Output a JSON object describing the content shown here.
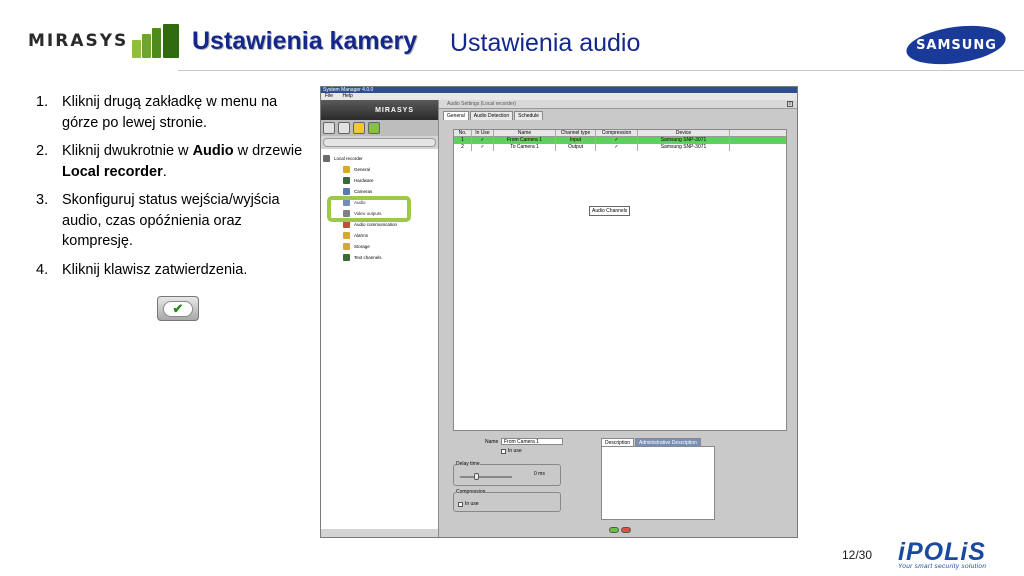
{
  "header": {
    "brand_left": "MIRASYS",
    "title": "Ustawienia kamery",
    "subtitle": "Ustawienia audio",
    "brand_right": "SAMSUNG"
  },
  "steps": [
    {
      "num": "1.",
      "parts": [
        {
          "t": "Kliknij drugą zakładkę w menu na górze po lewej stronie."
        }
      ]
    },
    {
      "num": "2.",
      "parts": [
        {
          "t": "Kliknij dwukrotnie w "
        },
        {
          "t": "Audio",
          "b": true
        },
        {
          "t": " w drzewie "
        },
        {
          "t": "Local recorder",
          "b": true
        },
        {
          "t": "."
        }
      ]
    },
    {
      "num": "3.",
      "parts": [
        {
          "t": "Skonfiguruj status wejścia/wyjścia audio, czas opóźnienia oraz kompresję."
        }
      ]
    },
    {
      "num": "4.",
      "parts": [
        {
          "t": "Kliknij klawisz zatwierdzenia."
        }
      ]
    }
  ],
  "confirm_icon": "checkmark-icon",
  "app": {
    "window_title": "System Manager 4.0.0",
    "menu": [
      "File",
      "Help"
    ],
    "banner": "MIRASYS",
    "tree": [
      {
        "label": "Local recorder",
        "level": 0,
        "icon": "sec"
      },
      {
        "label": "General",
        "level": 1,
        "icon": "g"
      },
      {
        "label": "Hardware",
        "level": 1,
        "icon": "c"
      },
      {
        "label": "Cameras",
        "level": 1,
        "icon": "b"
      },
      {
        "label": "Audio",
        "level": 1,
        "icon": "b"
      },
      {
        "label": "Video outputs",
        "level": 1,
        "icon": "sec"
      },
      {
        "label": "Audio communication",
        "level": 1,
        "icon": "r"
      },
      {
        "label": "Alarms",
        "level": 1,
        "icon": "g"
      },
      {
        "label": "Storage",
        "level": 1,
        "icon": "g"
      },
      {
        "label": "Text channels",
        "level": 1,
        "icon": "c"
      }
    ],
    "dialog_title": "Audio Settings (Local recorder)",
    "tabs": [
      "General",
      "Audio Detection",
      "Schedule"
    ],
    "table": {
      "columns": [
        "No.",
        "In Use",
        "Name",
        "Channel type",
        "Compression",
        "Device"
      ],
      "rows": [
        [
          "1",
          "✓",
          "From Camera 1",
          "Input",
          "✓",
          "Samsung SNP-3071"
        ],
        [
          "2",
          "✓",
          "To Camera 1",
          "Output",
          "✓",
          "Samsung SNP-3071"
        ]
      ],
      "selected_row": 0
    },
    "tooltip": "Audio Channels",
    "form": {
      "name_label": "Name",
      "name_value": "From Camera 1",
      "in_use_label": "In use",
      "delay_group": "Delay time",
      "delay_value": "0 ms",
      "compression_group": "Compression",
      "compression_in_use": "In use",
      "desc_tabs": [
        "Description",
        "Administrative Description"
      ]
    }
  },
  "page_number": "12/30",
  "footer_logo": {
    "brand": "iPOLiS",
    "tagline": "Your smart security solution"
  }
}
